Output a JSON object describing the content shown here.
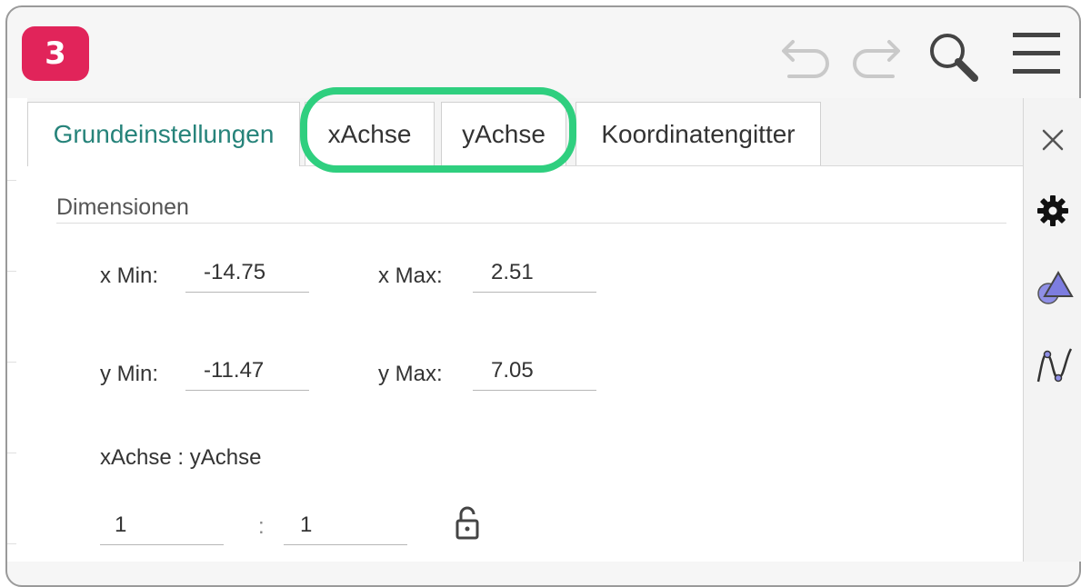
{
  "step_number": "3",
  "toolbar": {
    "undo_icon": "undo-icon",
    "redo_icon": "redo-icon",
    "search_icon": "search-icon",
    "menu_icon": "hamburger-menu-icon"
  },
  "tabs": [
    {
      "label": "Grundeinstellungen",
      "active": true
    },
    {
      "label": "xAchse",
      "active": false
    },
    {
      "label": "yAchse",
      "active": false
    },
    {
      "label": "Koordinatengitter",
      "active": false
    }
  ],
  "section": {
    "title": "Dimensionen"
  },
  "dimensions": {
    "x_min_label": "x Min:",
    "x_min_value": "-14.75",
    "x_max_label": "x Max:",
    "x_max_value": "2.51",
    "y_min_label": "y Min:",
    "y_min_value": "-11.47",
    "y_max_label": "y Max:",
    "y_max_value": "7.05"
  },
  "ratio": {
    "label": "xAchse : yAchse",
    "x_value": "1",
    "separator": ":",
    "y_value": "1",
    "lock_icon": "unlocked-padlock-icon"
  },
  "sidebar": {
    "close_icon": "close-icon",
    "icons": [
      "gear-icon",
      "shapes-icon",
      "graph-curve-icon"
    ]
  },
  "colors": {
    "badge": "#e1245a",
    "highlight": "#2fcf7f",
    "active_tab_text": "#26837a"
  }
}
